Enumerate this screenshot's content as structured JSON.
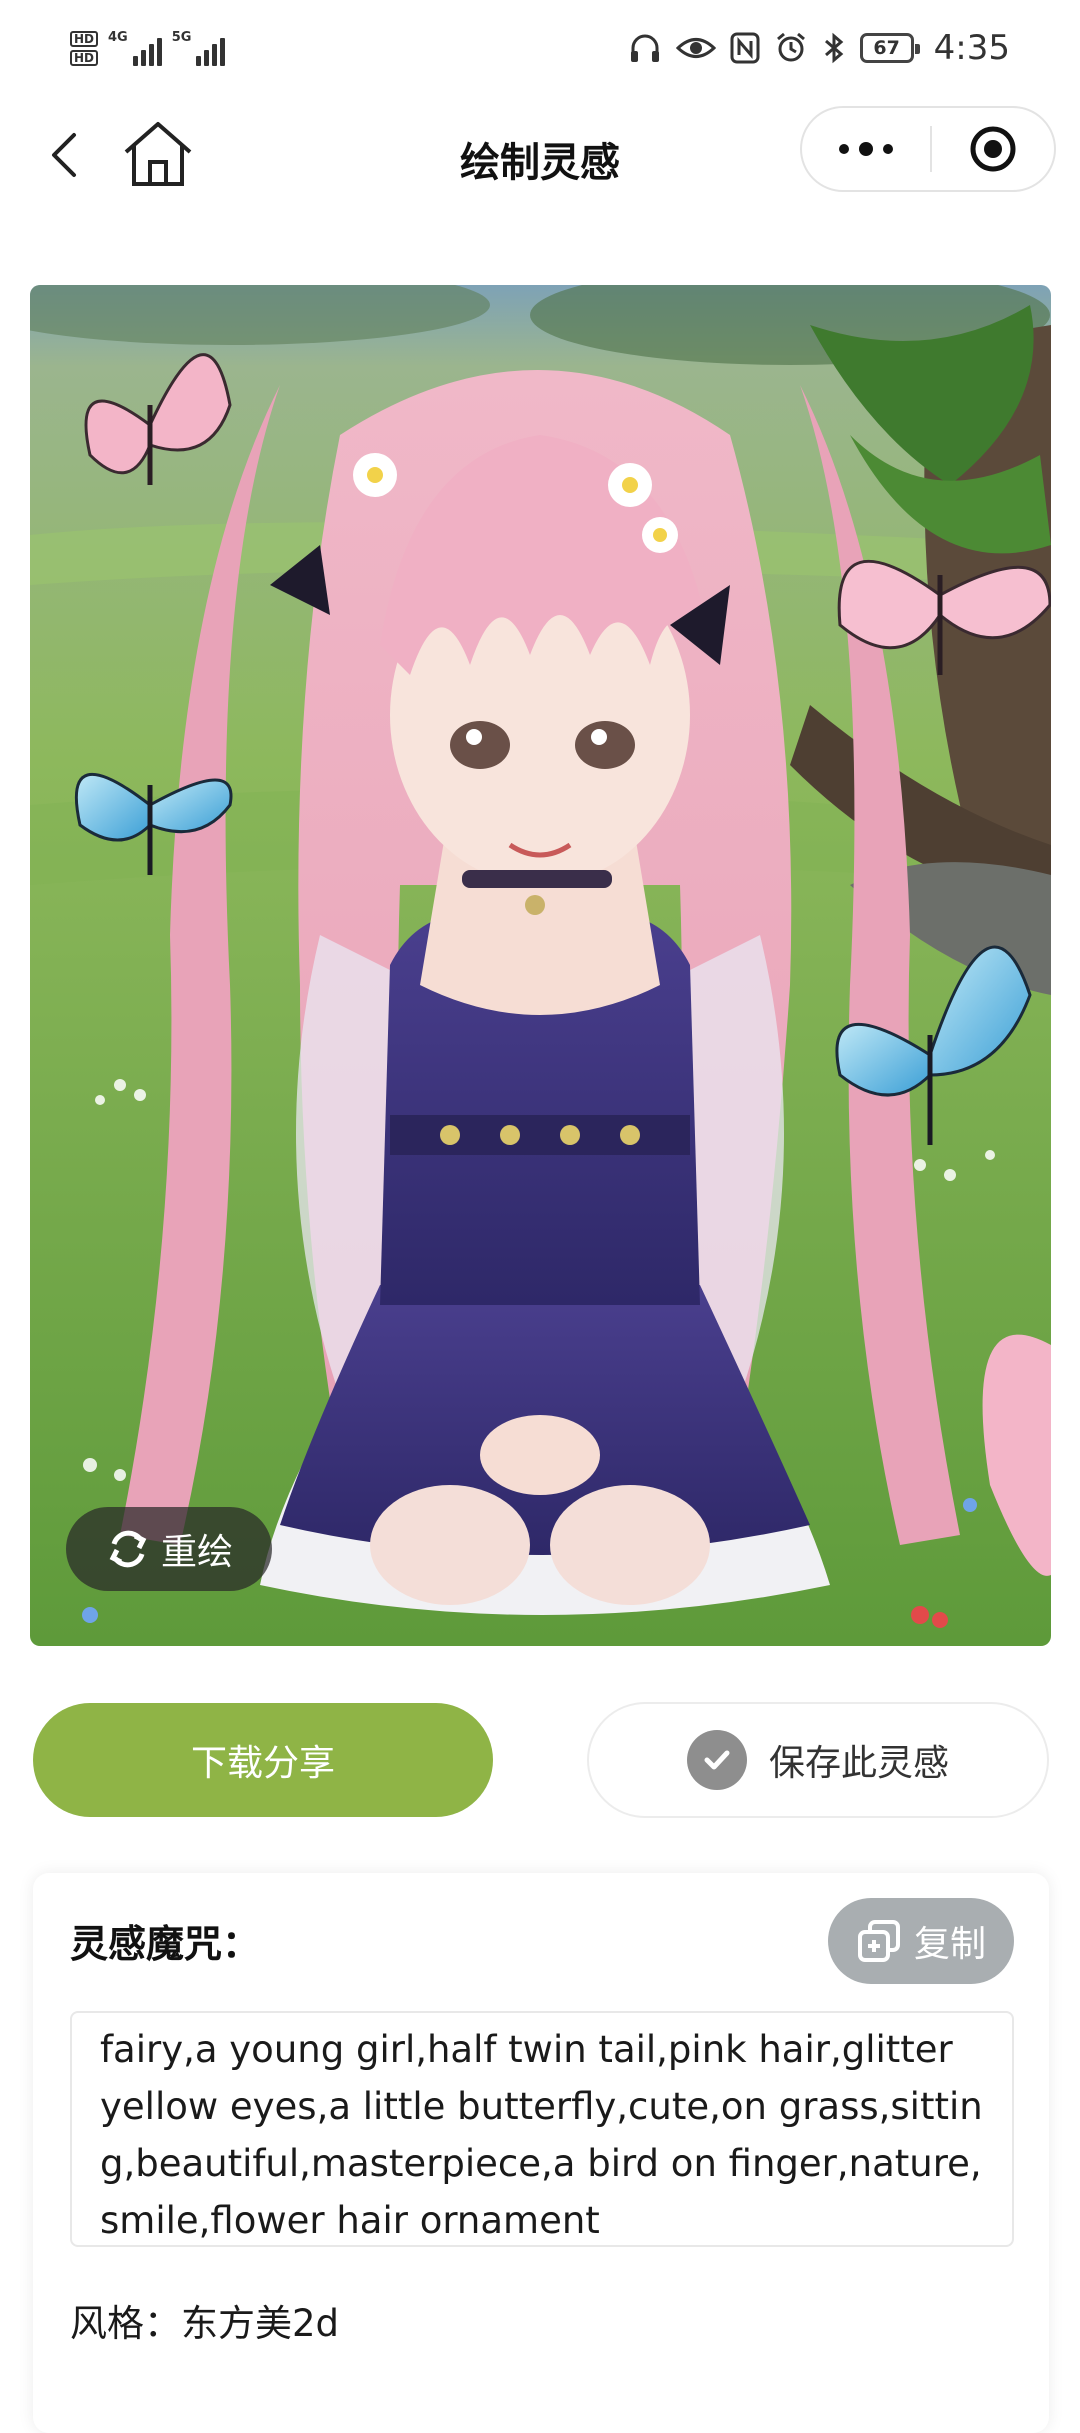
{
  "status_bar": {
    "hd_labels": [
      "HD",
      "HD"
    ],
    "network_1": "4G",
    "network_2": "5G",
    "battery_level": "67",
    "time": "4:35",
    "icons": [
      "headphones-icon",
      "eye-icon",
      "nfc-icon",
      "alarm-icon",
      "bluetooth-icon"
    ]
  },
  "nav": {
    "title": "绘制灵感",
    "icons": [
      "back-arrow-icon",
      "home-icon",
      "more-dots-icon",
      "close-target-icon"
    ]
  },
  "artwork": {
    "redraw_label": "重绘",
    "redraw_icon": "refresh-icon"
  },
  "actions": {
    "download_label": "下载分享",
    "download_color": "#8fb446",
    "save_label": "保存此灵感",
    "save_icon": "check-icon"
  },
  "prompt_card": {
    "title": "灵感魔咒：",
    "copy_label": "复制",
    "copy_icon": "copy-icon",
    "prompt_text": "fairy,a young girl,half twin tail,pink hair,glitter yellow eyes,a little butterfly,cute,on grass,sitting,beautiful,masterpiece,a bird on finger,nature,smile,flower hair ornament",
    "style_text": "风格：东方美2d"
  }
}
